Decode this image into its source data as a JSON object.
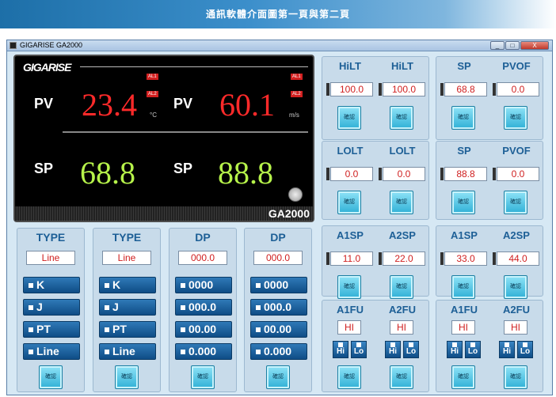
{
  "banner": {
    "title": "通訊軟體介面圖第一頁與第二頁"
  },
  "window": {
    "title": "GIGARISE    GA2000",
    "minimize": "_",
    "maximize": "□",
    "close": "X"
  },
  "display": {
    "logo": "GIGARISE",
    "pv1_label": "PV",
    "pv1_value": "23.4",
    "pv1_unit": "°C",
    "pv2_label": "PV",
    "pv2_value": "60.1",
    "pv2_unit": "m/s",
    "sp1_label": "SP",
    "sp1_value": "68.8",
    "sp2_label": "SP",
    "sp2_value": "88.8",
    "al1": "AL1",
    "al2": "AL2",
    "model": "GA2000"
  },
  "ok_label": "確認",
  "type_panels": [
    {
      "label": "TYPE",
      "value": "Line",
      "options": [
        "K",
        "J",
        "PT",
        "Line"
      ]
    },
    {
      "label": "TYPE",
      "value": "Line",
      "options": [
        "K",
        "J",
        "PT",
        "Line"
      ]
    }
  ],
  "dp_panels": [
    {
      "label": "DP",
      "value": "000.0",
      "options": [
        "0000",
        "000.0",
        "00.00",
        "0.000"
      ]
    },
    {
      "label": "DP",
      "value": "000.0",
      "options": [
        "0000",
        "000.0",
        "00.00",
        "0.000"
      ]
    }
  ],
  "param_panels": [
    {
      "label": "HiLT",
      "value": "100.0"
    },
    {
      "label": "HiLT",
      "value": "100.0"
    },
    {
      "label": "SP",
      "value": "68.8"
    },
    {
      "label": "PVOF",
      "value": "0.0"
    },
    {
      "label": "LOLT",
      "value": "0.0"
    },
    {
      "label": "LOLT",
      "value": "0.0"
    },
    {
      "label": "SP",
      "value": "88.8"
    },
    {
      "label": "PVOF",
      "value": "0.0"
    },
    {
      "label": "A1SP",
      "value": "11.0"
    },
    {
      "label": "A2SP",
      "value": "22.0"
    },
    {
      "label": "A1SP",
      "value": "33.0"
    },
    {
      "label": "A2SP",
      "value": "44.0"
    }
  ],
  "afu_panels": [
    {
      "label": "A1FU",
      "value": "HI"
    },
    {
      "label": "A2FU",
      "value": "HI"
    },
    {
      "label": "A1FU",
      "value": "HI"
    },
    {
      "label": "A2FU",
      "value": "HI"
    }
  ],
  "hilo": {
    "hi": "Hi",
    "lo": "Lo"
  }
}
